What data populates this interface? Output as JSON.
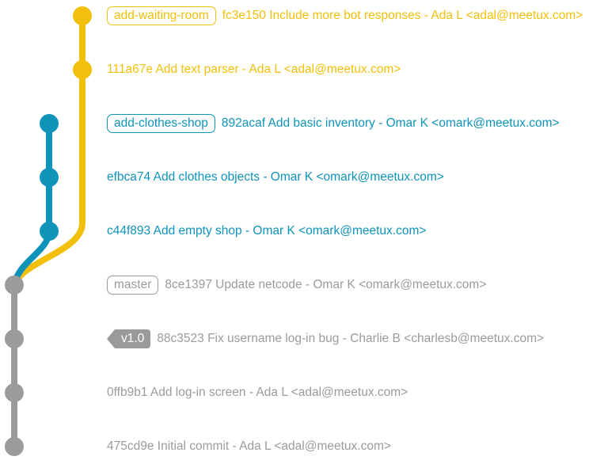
{
  "colors": {
    "yellow": "#f2c00c",
    "blue": "#0f93b9",
    "gray": "#9b9b9b"
  },
  "commits": [
    {
      "branch": "yellow",
      "ref": "add-waiting-room",
      "ref_type": "branch",
      "text": "fc3e150 Include more bot responses - Ada L <adal@meetux.com>"
    },
    {
      "branch": "yellow",
      "text": "111a67e Add text parser - Ada L <adal@meetux.com>"
    },
    {
      "branch": "blue",
      "ref": "add-clothes-shop",
      "ref_type": "branch",
      "text": "892acaf Add basic inventory - Omar K <omark@meetux.com>"
    },
    {
      "branch": "blue",
      "text": "efbca74 Add clothes objects - Omar K <omark@meetux.com>"
    },
    {
      "branch": "blue",
      "text": "c44f893 Add empty shop - Omar K <omark@meetux.com>"
    },
    {
      "branch": "gray",
      "ref": "master",
      "ref_type": "branch",
      "text": "8ce1397 Update netcode - Omar K <omark@meetux.com>"
    },
    {
      "branch": "gray",
      "ref": "v1.0",
      "ref_type": "tag",
      "text": "88c3523 Fix username log-in bug - Charlie B <charlesb@meetux.com>"
    },
    {
      "branch": "gray",
      "text": "0ffb9b1 Add log-in screen - Ada L <adal@meetux.com>"
    },
    {
      "branch": "gray",
      "text": "475cd9e Initial commit - Ada L <adal@meetux.com>"
    }
  ]
}
